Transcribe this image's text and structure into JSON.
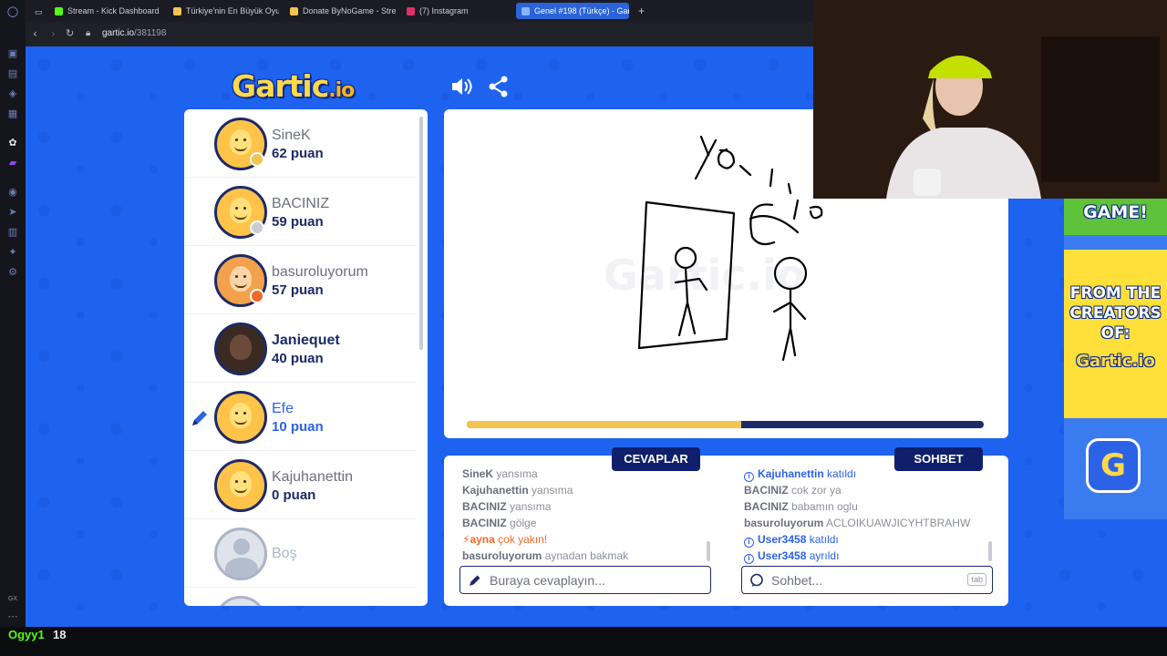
{
  "browser": {
    "tabs": [
      {
        "label": "Stream - Kick Dashboard",
        "favicon_color": "#53fc18"
      },
      {
        "label": "Türkiye'nin En Büyük Oyu",
        "favicon_color": "#f2c451"
      },
      {
        "label": "Donate ByNoGame - Strea",
        "favicon_color": "#f2c451"
      },
      {
        "label": "(7) Instagram",
        "favicon_color": "#e1306c"
      },
      {
        "label": "Genel #198 (Türkçe) - Gar",
        "favicon_color": "#2c62e6"
      }
    ],
    "new_tab_label": "+",
    "url_host": "gartic.io",
    "url_path": "/381198"
  },
  "header": {
    "logo_main": "Gartic",
    "logo_suffix": ".io",
    "sound_icon": "speaker-icon",
    "share_icon": "share-icon"
  },
  "players": [
    {
      "name": "SineK",
      "score": "62 puan",
      "avatar": "default",
      "status_color": "#f2c451"
    },
    {
      "name": "BACINIZ",
      "score": "59 puan",
      "avatar": "default",
      "status_color": "#c9ccd6"
    },
    {
      "name": "basuroluyorum",
      "score": "57 puan",
      "avatar": "ginger",
      "status_color": "#ef6a2a"
    },
    {
      "name": "Janiequet",
      "score": "40 puan",
      "avatar": "photo",
      "status_color": ""
    },
    {
      "name": "Efe",
      "score": "10 puan",
      "avatar": "default",
      "status_color": "",
      "drawing": true
    },
    {
      "name": "Kajuhanettin",
      "score": "0 puan",
      "avatar": "default",
      "status_color": ""
    },
    {
      "name": "Boş",
      "score": "",
      "avatar": "empty",
      "status_color": ""
    }
  ],
  "canvas": {
    "watermark": "Gartic.io",
    "timer_progress": 0.53,
    "timer_color": "#f2c451",
    "drawing_text": "yo",
    "drawing_text2": "yo"
  },
  "answers": {
    "tab_label": "CEVAPLAR",
    "messages": [
      {
        "user": "SineK",
        "text": "yansıma",
        "type": "guess"
      },
      {
        "user": "Kajuhanettin",
        "text": "yansıma",
        "type": "guess"
      },
      {
        "user": "BACINIZ",
        "text": "yansıma",
        "type": "guess"
      },
      {
        "user": "BACINIZ",
        "text": "gölge",
        "type": "guess"
      },
      {
        "user": "ayna",
        "text": "çok yakın!",
        "type": "close"
      },
      {
        "user": "basuroluyorum",
        "text": "aynadan bakmak",
        "type": "guess"
      }
    ],
    "placeholder": "Buraya cevaplayın..."
  },
  "chat": {
    "tab_label": "SOHBET",
    "messages": [
      {
        "user": "Kajuhanettin",
        "text": "katıldı",
        "type": "info"
      },
      {
        "user": "BACINIZ",
        "text": "cok zor ya",
        "type": "chat"
      },
      {
        "user": "BACINIZ",
        "text": "babamın oglu",
        "type": "chat"
      },
      {
        "user": "basuroluyorum",
        "text": "ACLOIKUAWJICYHTBRAHW",
        "type": "chat"
      },
      {
        "user": "User3458",
        "text": "katıldı",
        "type": "info"
      },
      {
        "user": "User3458",
        "text": "ayrıldı",
        "type": "info"
      }
    ],
    "placeholder": "Sohbet...",
    "shortcut": "tab"
  },
  "ad": {
    "line1": "GAME!",
    "line2": "FROM THE",
    "line3": "CREATORS",
    "line4": "OF:",
    "logo": "Gartic.io",
    "badge": "G"
  },
  "stream": {
    "viewer_name": "Ogyy1",
    "viewer_count": "18",
    "sidebar_bottom_label": "GX"
  },
  "colors": {
    "page_bg": "#1e63f0",
    "navy": "#0f1f6b",
    "drawer_blue": "#2c62e6",
    "kick_green": "#53fc18"
  }
}
